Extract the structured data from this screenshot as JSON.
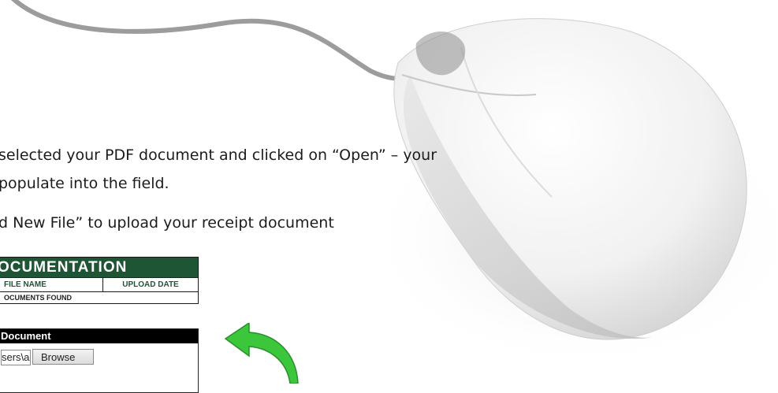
{
  "instructions": {
    "line1": "selected your PDF document and clicked on “Open” – your",
    "line2": "populate into the field.",
    "line3": "d New File” to upload your receipt document"
  },
  "documentation": {
    "title": "OCUMENTATION",
    "col_file": "FILE NAME",
    "col_date": "UPLOAD DATE",
    "empty_msg": "OCUMENTS FOUND"
  },
  "add_document": {
    "header": "Document",
    "file_value": "sers\\ab",
    "browse_label": "Browse"
  },
  "colors": {
    "header_green": "#1e5534",
    "arrow_green": "#3cc63c"
  },
  "icons": [
    "mouse-illustration",
    "green-curved-arrow-icon"
  ]
}
